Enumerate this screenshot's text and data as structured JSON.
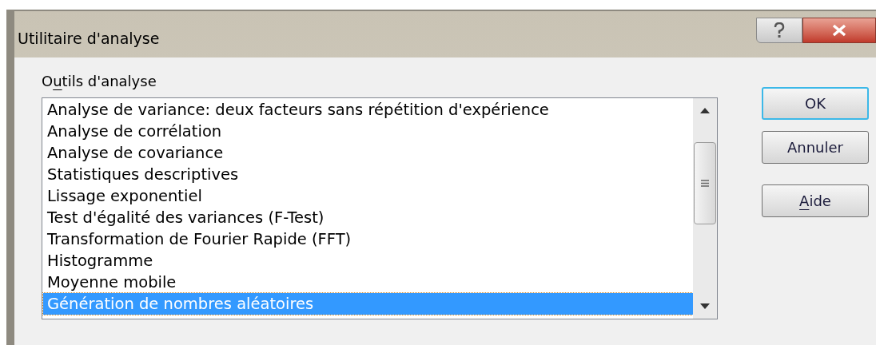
{
  "window": {
    "title": "Utilitaire d'analyse"
  },
  "list_label": {
    "segments": [
      {
        "text": "O",
        "underlined": false
      },
      {
        "text": "u",
        "underlined": true
      },
      {
        "text": "tils d'analyse",
        "underlined": false
      }
    ]
  },
  "items": [
    {
      "label": "Analyse de variance: deux facteurs sans répétition d'expérience",
      "selected": false
    },
    {
      "label": "Analyse de corrélation",
      "selected": false
    },
    {
      "label": "Analyse de covariance",
      "selected": false
    },
    {
      "label": "Statistiques descriptives",
      "selected": false
    },
    {
      "label": "Lissage exponentiel",
      "selected": false
    },
    {
      "label": "Test d'égalité des variances (F-Test)",
      "selected": false
    },
    {
      "label": "Transformation de Fourier Rapide (FFT)",
      "selected": false
    },
    {
      "label": "Histogramme",
      "selected": false
    },
    {
      "label": "Moyenne mobile",
      "selected": false
    },
    {
      "label": "Génération de nombres aléatoires",
      "selected": true
    }
  ],
  "buttons": [
    {
      "segments": [
        {
          "text": "OK",
          "underlined": false
        }
      ],
      "default": true
    },
    {
      "segments": [
        {
          "text": "Annuler",
          "underlined": false
        }
      ],
      "default": false
    },
    {
      "segments": [
        {
          "text": "A",
          "underlined": true
        },
        {
          "text": "ide",
          "underlined": false
        }
      ],
      "default": false
    }
  ]
}
